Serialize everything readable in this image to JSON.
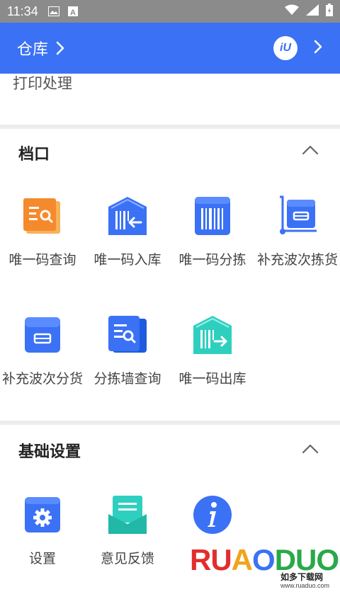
{
  "status_bar": {
    "time": "11:34",
    "icons": [
      "image-icon",
      "a-box-icon",
      "wifi-icon",
      "signal-icon",
      "battery-icon"
    ]
  },
  "app_bar": {
    "title": "仓库",
    "logo_text": "iU"
  },
  "top_card": {
    "print_label": "打印处理"
  },
  "stall": {
    "title": "档口",
    "items": [
      {
        "label": "唯一码查询",
        "icon": "list-search-icon"
      },
      {
        "label": "唯一码入库",
        "icon": "barcode-inbound-icon"
      },
      {
        "label": "唯一码分拣",
        "icon": "barcode-sort-icon"
      },
      {
        "label": "补充波次拣货",
        "icon": "cart-box-icon"
      },
      {
        "label": "补充波次分货",
        "icon": "box-icon"
      },
      {
        "label": "分拣墙查询",
        "icon": "doc-search-icon"
      },
      {
        "label": "唯一码出库",
        "icon": "barcode-outbound-icon"
      }
    ]
  },
  "basic": {
    "title": "基础设置",
    "items": [
      {
        "label": "设置",
        "icon": "gear-icon"
      },
      {
        "label": "意见反馈",
        "icon": "feedback-icon"
      },
      {
        "label": "",
        "icon": "info-icon"
      }
    ]
  },
  "watermark": {
    "main": "RUAODUO",
    "sub": "如多下载网",
    "url": "www.ruaduo.com"
  },
  "colors": {
    "primary": "#3b71f5",
    "orange": "#f7a13c",
    "teal": "#2fcfbf"
  }
}
